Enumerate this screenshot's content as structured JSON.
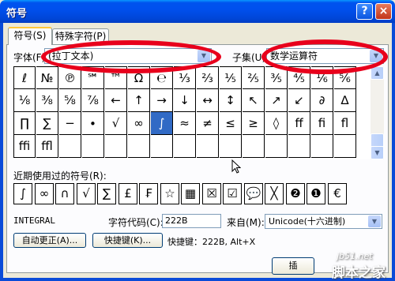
{
  "window": {
    "title": "符号",
    "help_label": "?",
    "close_label": "×"
  },
  "tabs": [
    {
      "label": "符号(S)"
    },
    {
      "label": "特殊字符(P)"
    }
  ],
  "font": {
    "label": "字体(F):",
    "value": "(拉丁文本)"
  },
  "subset": {
    "label": "子集(U):",
    "value": "数学运算符"
  },
  "symbols": [
    [
      "ℓ",
      "№",
      "℗",
      "℠",
      "™",
      "Ω",
      "℮",
      "⅓",
      "⅔",
      "⅕",
      "⅖",
      "⅗",
      "⅘",
      "⅙",
      "⅚"
    ],
    [
      "⅛",
      "⅜",
      "⅝",
      "⅞",
      "←",
      "↑",
      "→",
      "↓",
      "↔",
      "↕",
      "↖",
      "↗",
      "↙",
      "∂",
      "∆"
    ],
    [
      "∏",
      "∑",
      "−",
      "∙",
      "√",
      "∞",
      "∫",
      "≈",
      "≠",
      "≤",
      "≥",
      "◊",
      "ﬀ",
      "ﬁ",
      "ﬂ"
    ],
    [
      "ﬃ",
      "ﬄ",
      "",
      "",
      "",
      "",
      "",
      "",
      "",
      "",
      "",
      "",
      "",
      "",
      ""
    ]
  ],
  "recent_label": "近期使用过的符号(R):",
  "recent": [
    "∫",
    "∞",
    "∩",
    "√",
    "∑",
    "£",
    "₣",
    "☆",
    "▦",
    "☒",
    "☑",
    "💬",
    "╳",
    "❷",
    "❶",
    "€"
  ],
  "char_name": "INTEGRAL",
  "char_code": {
    "label": "字符代码(C):",
    "value": "222B"
  },
  "from": {
    "label": "来自(M):",
    "value": "Unicode(十六进制)"
  },
  "autocorrect_label": "自动更正(A)...",
  "shortcut_button_label": "快捷键(K)...",
  "shortcut_text": "快捷键：222B, Alt+X",
  "insert_label": "插",
  "watermark": {
    "site": "jb51.net",
    "name": "脚本之家"
  },
  "colors": {
    "highlight": "#e8001c",
    "selection": "#316ac5",
    "titlebar": "#0050ee"
  }
}
